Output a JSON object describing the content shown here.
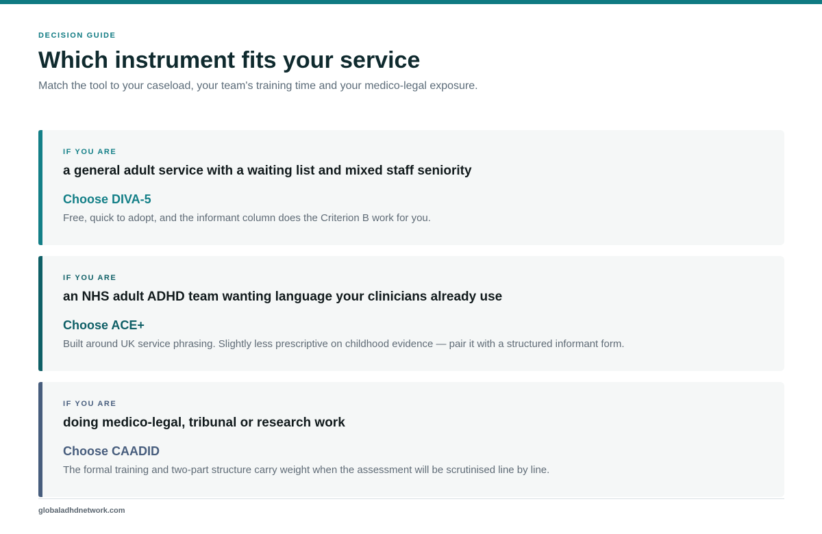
{
  "header": {
    "eyebrow": "DECISION GUIDE",
    "title": "Which instrument fits your service",
    "subtitle": "Match the tool to your caseload, your team's training time and your medico-legal exposure."
  },
  "cards": [
    {
      "eyebrow": "IF YOU ARE",
      "situation": "a general adult service with a waiting list and mixed staff seniority",
      "choice": "Choose DIVA-5",
      "description": "Free, quick to adopt, and the informant column does the Criterion B work for you.",
      "accent_color": "#137f87",
      "choice_color": "#137f87"
    },
    {
      "eyebrow": "IF YOU ARE",
      "situation": "an NHS adult ADHD team wanting language your clinicians already use",
      "choice": "Choose ACE+",
      "description": "Built around UK service phrasing. Slightly less prescriptive on childhood evidence — pair it with a structured informant form.",
      "accent_color": "#0e5f66",
      "choice_color": "#0e5f66"
    },
    {
      "eyebrow": "IF YOU ARE",
      "situation": "doing medico-legal, tribunal or research work",
      "choice": "Choose CAADID",
      "description": "The formal training and two-part structure carry weight when the assessment will be scrutinised line by line.",
      "accent_color": "#475d7d",
      "choice_color": "#475d7d"
    }
  ],
  "footer": {
    "site": "globaladhdnetwork.com"
  },
  "colors": {
    "brand_teal": "#0f7a82",
    "title": "#0f2a2e",
    "card_bg": "#f5f7f7"
  }
}
